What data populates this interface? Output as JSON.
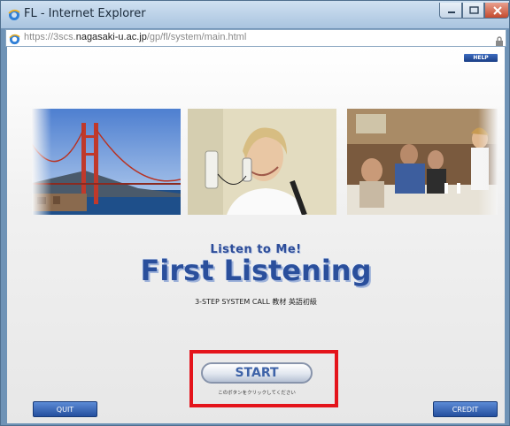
{
  "window": {
    "title": "FL - Internet Explorer",
    "url_prefix": "https://3scs.",
    "url_host": "nagasaki-u.ac.jp",
    "url_path": "/gp/fl/system/main.html"
  },
  "app": {
    "help_label": "HELP",
    "subtitle": "Listen to Me!",
    "title": "First Listening",
    "tagline": "3-STEP SYSTEM CALL 教材 英語初級",
    "start_label": "START",
    "start_note": "このボタンをクリックしてください",
    "quit_label": "QUIT",
    "credit_label": "CREDIT",
    "photos": [
      "golden-gate-bridge-photo",
      "woman-on-phone-photo",
      "restaurant-diners-photo"
    ]
  },
  "colors": {
    "accent": "#2a4f9c",
    "highlight": "#e4141b",
    "button_blue": "#244f9e"
  }
}
